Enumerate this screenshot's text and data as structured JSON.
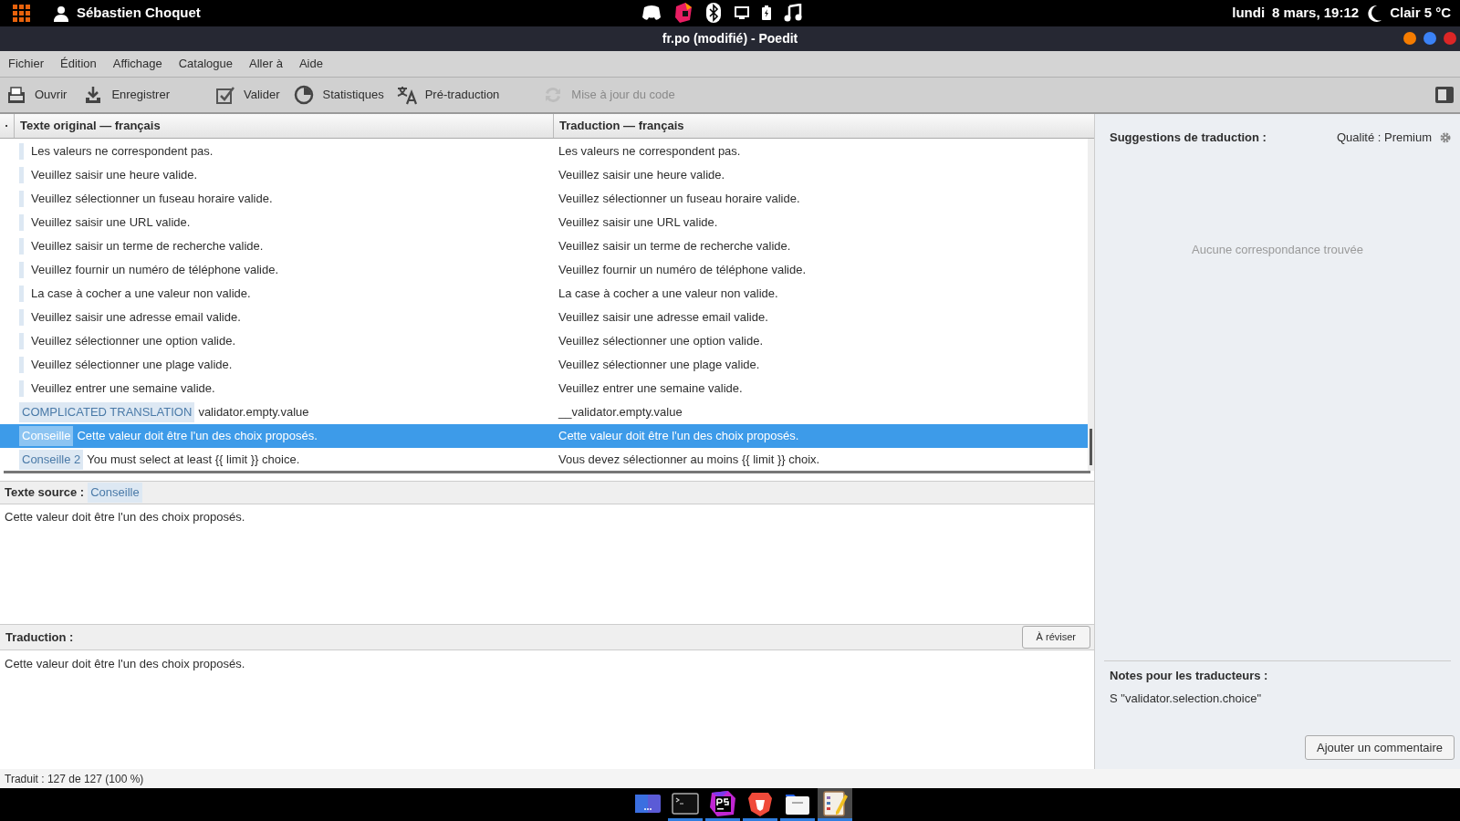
{
  "top_bar": {
    "user": "Sébastien Choquet",
    "day": "lundi",
    "date_time": "8 mars, 19:12",
    "weather": "Clair 5 °C"
  },
  "window": {
    "title": "fr.po (modifié) - Poedit"
  },
  "menu": [
    "Fichier",
    "Édition",
    "Affichage",
    "Catalogue",
    "Aller à",
    "Aide"
  ],
  "toolbar": [
    {
      "kind": "open",
      "label": "Ouvrir",
      "disabled": false
    },
    {
      "kind": "save",
      "label": "Enregistrer",
      "disabled": false
    },
    {
      "kind": "validate",
      "label": "Valider",
      "disabled": false
    },
    {
      "kind": "stats",
      "label": "Statistiques",
      "disabled": false
    },
    {
      "kind": "pretranslate",
      "label": "Pré-traduction",
      "disabled": false
    },
    {
      "kind": "update",
      "label": "Mise à jour du code",
      "disabled": true
    }
  ],
  "table": {
    "columns": [
      "·",
      "Texte original — français",
      "Traduction — français"
    ],
    "rows": [
      {
        "source": "Les valeurs ne correspondent pas.",
        "translation": "Les valeurs ne correspondent pas.",
        "selected": false
      },
      {
        "source": "Veuillez saisir une heure valide.",
        "translation": "Veuillez saisir une heure valide.",
        "selected": false
      },
      {
        "source": "Veuillez sélectionner un fuseau horaire valide.",
        "translation": "Veuillez sélectionner un fuseau horaire valide.",
        "selected": false
      },
      {
        "source": "Veuillez saisir une URL valide.",
        "translation": "Veuillez saisir une URL valide.",
        "selected": false
      },
      {
        "source": "Veuillez saisir un terme de recherche valide.",
        "translation": "Veuillez saisir un terme de recherche valide.",
        "selected": false
      },
      {
        "source": "Veuillez fournir un numéro de téléphone valide.",
        "translation": "Veuillez fournir un numéro de téléphone valide.",
        "selected": false
      },
      {
        "source": "La case à cocher a une valeur non valide.",
        "translation": "La case à cocher a une valeur non valide.",
        "selected": false
      },
      {
        "source": "Veuillez saisir une adresse email valide.",
        "translation": "Veuillez saisir une adresse email valide.",
        "selected": false
      },
      {
        "source": "Veuillez sélectionner une option valide.",
        "translation": "Veuillez sélectionner une option valide.",
        "selected": false
      },
      {
        "source": "Veuillez sélectionner une plage valide.",
        "translation": "Veuillez sélectionner une plage valide.",
        "selected": false
      },
      {
        "source": "Veuillez entrer une semaine valide.",
        "translation": "Veuillez entrer une semaine valide.",
        "selected": false
      },
      {
        "tag": "COMPLICATED TRANSLATION",
        "source": "validator.empty.value",
        "translation": "__validator.empty.value",
        "selected": false
      },
      {
        "tag": "Conseille",
        "source": "Cette valeur doit être l'un des choix proposés.",
        "translation": "Cette valeur doit être l'un des choix proposés.",
        "selected": true
      },
      {
        "tag": "Conseille 2",
        "source": "You must select at least {{ limit }} choice.",
        "translation": "Vous devez sélectionner au moins {{ limit }} choix.",
        "selected": false
      }
    ]
  },
  "source_panel": {
    "label": "Texte source :",
    "tag": "Conseille",
    "text": "Cette valeur doit être l'un des choix proposés."
  },
  "translation_panel": {
    "label": "Traduction :",
    "button": "À réviser",
    "text": "Cette valeur doit être l'un des choix proposés."
  },
  "suggestions": {
    "title": "Suggestions de traduction :",
    "quality": "Qualité : Premium",
    "empty": "Aucune correspondance trouvée"
  },
  "notes": {
    "title": "Notes pour les traducteurs :",
    "text": "S \"validator.selection.choice\"",
    "button": "Ajouter un commentaire"
  },
  "status_bar": "Traduit : 127 de 127 (100 %)",
  "dock": [
    {
      "kind": "workspaces",
      "running": false,
      "selected": false
    },
    {
      "kind": "terminal",
      "running": true,
      "selected": false
    },
    {
      "kind": "ide",
      "running": true,
      "selected": false
    },
    {
      "kind": "browser",
      "running": true,
      "selected": false
    },
    {
      "kind": "files",
      "running": true,
      "selected": false
    },
    {
      "kind": "editor",
      "running": true,
      "selected": true
    }
  ]
}
